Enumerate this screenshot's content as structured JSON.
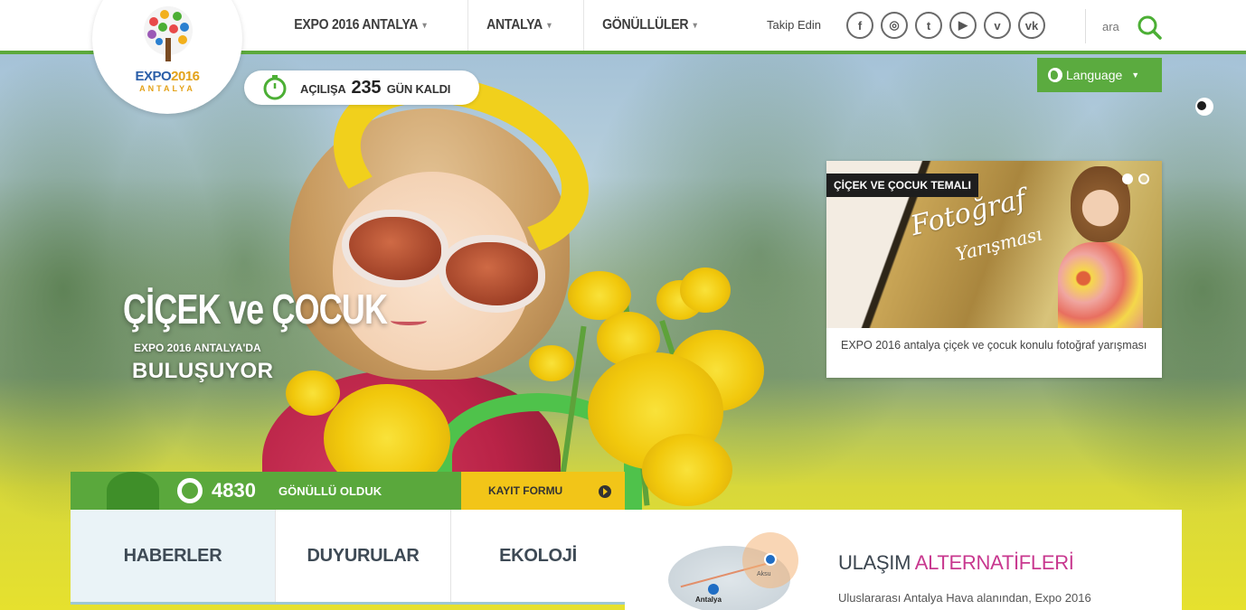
{
  "nav": {
    "items": [
      {
        "label": "EXPO 2016 ANTALYA",
        "caret": "▾"
      },
      {
        "label": "ANTALYA",
        "caret": "▾"
      },
      {
        "label": "GÖNÜLLÜLER",
        "caret": "▾"
      }
    ]
  },
  "follow_label": "Takip Edin",
  "socials": [
    {
      "icon": "facebook-icon",
      "glyph": "f"
    },
    {
      "icon": "instagram-icon",
      "glyph": "◎"
    },
    {
      "icon": "twitter-icon",
      "glyph": "t"
    },
    {
      "icon": "youtube-icon",
      "glyph": "▶"
    },
    {
      "icon": "vimeo-icon",
      "glyph": "v"
    },
    {
      "icon": "vk-icon",
      "glyph": "vk"
    }
  ],
  "search_label": "ara",
  "logo": {
    "text_a": "EXPO",
    "text_b": "2016",
    "sub": "ANTALYA"
  },
  "countdown": {
    "prefix": "AÇILIŞA",
    "days": "235",
    "suffix": "GÜN KALDI"
  },
  "language_label": "Language",
  "hero": {
    "title": "ÇİÇEK ve ÇOCUK",
    "sub1": "EXPO 2016 ANTALYA'DA",
    "sub2": "BULUŞUYOR"
  },
  "card": {
    "tag": "ÇİÇEK VE ÇOCUK TEMALI",
    "script1": "Fotoğraf",
    "script2": "Yarışması",
    "caption": "EXPO 2016 antalya çiçek ve çocuk konulu fotoğraf yarışması"
  },
  "volunteers": {
    "count": "4830",
    "text": "GÖNÜLLÜ OLDUK",
    "register": "KAYIT FORMU"
  },
  "tabs": [
    "HABERLER",
    "DUYURULAR",
    "EKOLOJİ"
  ],
  "transport": {
    "title_a": "ULAŞIM",
    "title_b": "ALTERNATİFLERİ",
    "text": "Uluslararası Antalya Hava alanından, Expo 2016",
    "map_label1": "Aksu",
    "map_label2": "Antalya"
  },
  "colors": {
    "brand_green": "#5ca93c",
    "accent_yellow": "#f2c518",
    "accent_pink": "#c8388f"
  }
}
